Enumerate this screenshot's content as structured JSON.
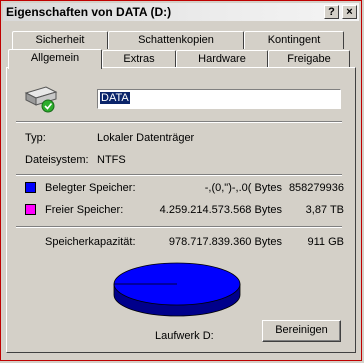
{
  "window": {
    "title": "Eigenschaften von DATA (D:)",
    "help_label": "?",
    "close_label": "×"
  },
  "tabs_row1": [
    {
      "label": "Sicherheit"
    },
    {
      "label": "Schattenkopien"
    },
    {
      "label": "Kontingent"
    }
  ],
  "tabs_row2": [
    {
      "label": "Allgemein",
      "active": true
    },
    {
      "label": "Extras"
    },
    {
      "label": "Hardware"
    },
    {
      "label": "Freigabe"
    }
  ],
  "drive": {
    "name": "DATA",
    "icon": "drive-icon"
  },
  "info": {
    "type_label": "Typ:",
    "type_value": "Lokaler Datenträger",
    "fs_label": "Dateisystem:",
    "fs_value": "NTFS"
  },
  "space": {
    "used_label": "Belegter Speicher:",
    "used_bytes": "-,(0,\")-,.0( Bytes",
    "used_short": "858279936",
    "used_color": "#0000ff",
    "free_label": "Freier Speicher:",
    "free_bytes": "4.259.214.573.568 Bytes",
    "free_short": "3,87 TB",
    "free_color": "#ff00ff",
    "capacity_label": "Speicherkapazität:",
    "capacity_bytes": "978.717.839.360 Bytes",
    "capacity_short": "911 GB"
  },
  "footer": {
    "drive_label": "Laufwerk D:",
    "cleanup_label": "Bereinigen"
  }
}
